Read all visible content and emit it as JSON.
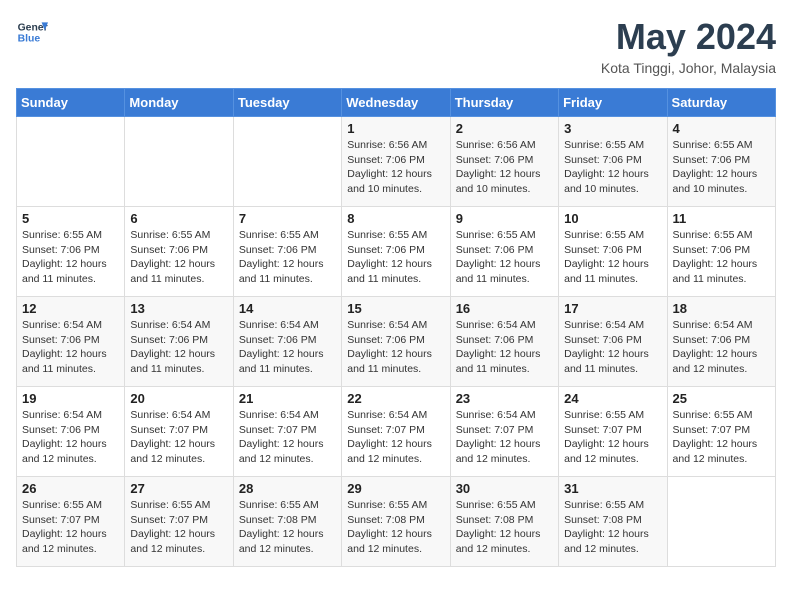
{
  "logo": {
    "line1": "General",
    "line2": "Blue"
  },
  "title": "May 2024",
  "location": "Kota Tinggi, Johor, Malaysia",
  "headers": [
    "Sunday",
    "Monday",
    "Tuesday",
    "Wednesday",
    "Thursday",
    "Friday",
    "Saturday"
  ],
  "weeks": [
    [
      {
        "day": "",
        "detail": ""
      },
      {
        "day": "",
        "detail": ""
      },
      {
        "day": "",
        "detail": ""
      },
      {
        "day": "1",
        "detail": "Sunrise: 6:56 AM\nSunset: 7:06 PM\nDaylight: 12 hours\nand 10 minutes."
      },
      {
        "day": "2",
        "detail": "Sunrise: 6:56 AM\nSunset: 7:06 PM\nDaylight: 12 hours\nand 10 minutes."
      },
      {
        "day": "3",
        "detail": "Sunrise: 6:55 AM\nSunset: 7:06 PM\nDaylight: 12 hours\nand 10 minutes."
      },
      {
        "day": "4",
        "detail": "Sunrise: 6:55 AM\nSunset: 7:06 PM\nDaylight: 12 hours\nand 10 minutes."
      }
    ],
    [
      {
        "day": "5",
        "detail": "Sunrise: 6:55 AM\nSunset: 7:06 PM\nDaylight: 12 hours\nand 11 minutes."
      },
      {
        "day": "6",
        "detail": "Sunrise: 6:55 AM\nSunset: 7:06 PM\nDaylight: 12 hours\nand 11 minutes."
      },
      {
        "day": "7",
        "detail": "Sunrise: 6:55 AM\nSunset: 7:06 PM\nDaylight: 12 hours\nand 11 minutes."
      },
      {
        "day": "8",
        "detail": "Sunrise: 6:55 AM\nSunset: 7:06 PM\nDaylight: 12 hours\nand 11 minutes."
      },
      {
        "day": "9",
        "detail": "Sunrise: 6:55 AM\nSunset: 7:06 PM\nDaylight: 12 hours\nand 11 minutes."
      },
      {
        "day": "10",
        "detail": "Sunrise: 6:55 AM\nSunset: 7:06 PM\nDaylight: 12 hours\nand 11 minutes."
      },
      {
        "day": "11",
        "detail": "Sunrise: 6:55 AM\nSunset: 7:06 PM\nDaylight: 12 hours\nand 11 minutes."
      }
    ],
    [
      {
        "day": "12",
        "detail": "Sunrise: 6:54 AM\nSunset: 7:06 PM\nDaylight: 12 hours\nand 11 minutes."
      },
      {
        "day": "13",
        "detail": "Sunrise: 6:54 AM\nSunset: 7:06 PM\nDaylight: 12 hours\nand 11 minutes."
      },
      {
        "day": "14",
        "detail": "Sunrise: 6:54 AM\nSunset: 7:06 PM\nDaylight: 12 hours\nand 11 minutes."
      },
      {
        "day": "15",
        "detail": "Sunrise: 6:54 AM\nSunset: 7:06 PM\nDaylight: 12 hours\nand 11 minutes."
      },
      {
        "day": "16",
        "detail": "Sunrise: 6:54 AM\nSunset: 7:06 PM\nDaylight: 12 hours\nand 11 minutes."
      },
      {
        "day": "17",
        "detail": "Sunrise: 6:54 AM\nSunset: 7:06 PM\nDaylight: 12 hours\nand 11 minutes."
      },
      {
        "day": "18",
        "detail": "Sunrise: 6:54 AM\nSunset: 7:06 PM\nDaylight: 12 hours\nand 12 minutes."
      }
    ],
    [
      {
        "day": "19",
        "detail": "Sunrise: 6:54 AM\nSunset: 7:06 PM\nDaylight: 12 hours\nand 12 minutes."
      },
      {
        "day": "20",
        "detail": "Sunrise: 6:54 AM\nSunset: 7:07 PM\nDaylight: 12 hours\nand 12 minutes."
      },
      {
        "day": "21",
        "detail": "Sunrise: 6:54 AM\nSunset: 7:07 PM\nDaylight: 12 hours\nand 12 minutes."
      },
      {
        "day": "22",
        "detail": "Sunrise: 6:54 AM\nSunset: 7:07 PM\nDaylight: 12 hours\nand 12 minutes."
      },
      {
        "day": "23",
        "detail": "Sunrise: 6:54 AM\nSunset: 7:07 PM\nDaylight: 12 hours\nand 12 minutes."
      },
      {
        "day": "24",
        "detail": "Sunrise: 6:55 AM\nSunset: 7:07 PM\nDaylight: 12 hours\nand 12 minutes."
      },
      {
        "day": "25",
        "detail": "Sunrise: 6:55 AM\nSunset: 7:07 PM\nDaylight: 12 hours\nand 12 minutes."
      }
    ],
    [
      {
        "day": "26",
        "detail": "Sunrise: 6:55 AM\nSunset: 7:07 PM\nDaylight: 12 hours\nand 12 minutes."
      },
      {
        "day": "27",
        "detail": "Sunrise: 6:55 AM\nSunset: 7:07 PM\nDaylight: 12 hours\nand 12 minutes."
      },
      {
        "day": "28",
        "detail": "Sunrise: 6:55 AM\nSunset: 7:08 PM\nDaylight: 12 hours\nand 12 minutes."
      },
      {
        "day": "29",
        "detail": "Sunrise: 6:55 AM\nSunset: 7:08 PM\nDaylight: 12 hours\nand 12 minutes."
      },
      {
        "day": "30",
        "detail": "Sunrise: 6:55 AM\nSunset: 7:08 PM\nDaylight: 12 hours\nand 12 minutes."
      },
      {
        "day": "31",
        "detail": "Sunrise: 6:55 AM\nSunset: 7:08 PM\nDaylight: 12 hours\nand 12 minutes."
      },
      {
        "day": "",
        "detail": ""
      }
    ]
  ]
}
